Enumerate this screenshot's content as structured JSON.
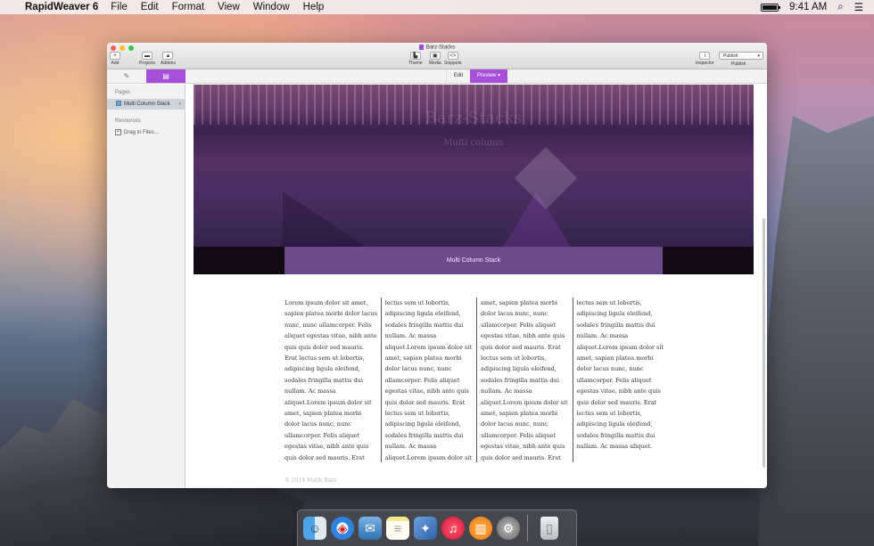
{
  "menubar": {
    "apple_glyph": "",
    "app_name": "RapidWeaver 6",
    "items": [
      "File",
      "Edit",
      "Format",
      "View",
      "Window",
      "Help"
    ],
    "time": "9:41 AM",
    "search_glyph": "⌕",
    "list_glyph": "☰"
  },
  "window": {
    "title": "Barz-Stacks",
    "toolbar": {
      "add_label": "Add",
      "add_glyph": "+",
      "projects_label": "Projects",
      "addons_label": "Addons",
      "theme_label": "Theme",
      "media_label": "Media",
      "snippets_label": "Snippets",
      "snippets_glyph": "<>",
      "inspector_label": "Inspector",
      "inspector_glyph": "i",
      "publish_button": "Publish",
      "publish_label": "Publish"
    },
    "subbar": {
      "tools_glyph": "✎",
      "pages_glyph": "▤",
      "edit_label": "Edit",
      "preview_label": "Preview"
    },
    "sidebar": {
      "pages_header": "Pages",
      "page_item": "Multi Column Stack",
      "resources_header": "Resources",
      "drag_label": "Drag in Files...",
      "drag_glyph": "+"
    },
    "preview": {
      "hero_title": "Barz-Stacks",
      "hero_subtitle": "Multi column",
      "band_label": "Multi Column Stack",
      "columns": [
        "Lorem ipsum dolor sit amet, sapien platea morbi dolor lacus nunc, nunc ullamcorper. Felis aliquet egestas vitae, nibh ante quis quis dolor sed mauris. Erat lectus sem ut lobortis, adipiscing ligula eleifend, sodales fringilla mattis dui nullam. Ac massa aliquet.Lorem ipsum dolor sit amet, sapien platea morbi dolor lacus nunc, nunc ullamcorper. Felis aliquet egestas vitae, nibh ante quis quis dolor sed mauris. Erat",
        "lectus sem ut lobortis, adipiscing ligula eleifend, sodales fringilla mattis dui nullam. Ac massa aliquet.Lorem ipsum dolor sit amet, sapien platea morbi dolor lacus nunc, nunc ullamcorper. Felis aliquet egestas vitae, nibh ante quis quis dolor sed mauris. Erat lectus sem ut lobortis, adipiscing ligula eleifend, sodales fringilla mattis dui nullam. Ac massa aliquet.Lorem ipsum dolor sit",
        "amet, sapien platea morbi dolor lacus nunc, nunc ullamcorper. Felis aliquet egestas vitae, nibh ante quis quis dolor sed mauris. Erat lectus sem ut lobortis, adipiscing ligula eleifend, sodales fringilla mattis dui nullam. Ac massa aliquet.Lorem ipsum dolor sit amet, sapien platea morbi dolor lacus nunc, nunc ullamcorper. Felis aliquet egestas vitae, nibh ante quis quis dolor sed mauris. Erat",
        "lectus sem ut lobortis, adipiscing ligula eleifend, sodales fringilla mattis dui nullam. Ac massa aliquet.Lorem ipsum dolor sit amet, sapien platea morbi dolor lacus nunc, nunc ullamcorper. Felis aliquet egestas vitae, nibh ante quis quis dolor sed mauris. Erat lectus sem ut lobortis, adipiscing ligula eleifend, sodales fringilla mattis dui nullam. Ac massa aliquet."
      ],
      "footer": "© 2014 Malik Barz"
    }
  },
  "dock": {
    "finder_glyph": "☺",
    "safari_glyph": "◈",
    "mail_glyph": "✉",
    "notes_glyph": "≡",
    "rw_glyph": "✦",
    "itunes_glyph": "♫",
    "ibooks_glyph": "▥",
    "prefs_glyph": "⚙",
    "trash_glyph": "▯"
  },
  "colors": {
    "accent": "#a64fd8",
    "band": "#6d4a8a"
  }
}
